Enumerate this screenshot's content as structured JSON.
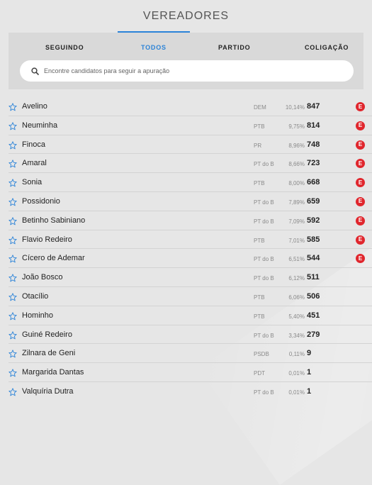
{
  "header": {
    "title": "VEREADORES"
  },
  "tabs": [
    {
      "label": "SEGUINDO"
    },
    {
      "label": "TODOS"
    },
    {
      "label": "PARTIDO"
    },
    {
      "label": "COLIGAÇÃO"
    }
  ],
  "search": {
    "placeholder": "Encontre candidatos para seguir a apuração",
    "icon": "search-icon"
  },
  "colors": {
    "accent": "#2b83d8",
    "elected_badge": "#e0262d",
    "star": "#2b83d8"
  },
  "elected_badge_label": "E",
  "candidates": [
    {
      "name": "Avelino",
      "party": "DEM",
      "pct": "10,14%",
      "votes": "847",
      "elected": true
    },
    {
      "name": "Neuminha",
      "party": "PTB",
      "pct": "9,75%",
      "votes": "814",
      "elected": true
    },
    {
      "name": "Finoca",
      "party": "PR",
      "pct": "8,96%",
      "votes": "748",
      "elected": true
    },
    {
      "name": "Amaral",
      "party": "PT do B",
      "pct": "8,66%",
      "votes": "723",
      "elected": true
    },
    {
      "name": "Sonia",
      "party": "PTB",
      "pct": "8,00%",
      "votes": "668",
      "elected": true
    },
    {
      "name": "Possidonio",
      "party": "PT do B",
      "pct": "7,89%",
      "votes": "659",
      "elected": true
    },
    {
      "name": "Betinho Sabiniano",
      "party": "PT do B",
      "pct": "7,09%",
      "votes": "592",
      "elected": true
    },
    {
      "name": "Flavio Redeiro",
      "party": "PTB",
      "pct": "7,01%",
      "votes": "585",
      "elected": true
    },
    {
      "name": "Cícero de Ademar",
      "party": "PT do B",
      "pct": "6,51%",
      "votes": "544",
      "elected": true
    },
    {
      "name": "João Bosco",
      "party": "PT do B",
      "pct": "6,12%",
      "votes": "511",
      "elected": false
    },
    {
      "name": "Otacílio",
      "party": "PTB",
      "pct": "6,06%",
      "votes": "506",
      "elected": false
    },
    {
      "name": "Hominho",
      "party": "PTB",
      "pct": "5,40%",
      "votes": "451",
      "elected": false
    },
    {
      "name": "Guiné Redeiro",
      "party": "PT do B",
      "pct": "3,34%",
      "votes": "279",
      "elected": false
    },
    {
      "name": "Zilnara de Geni",
      "party": "PSDB",
      "pct": "0,11%",
      "votes": "9",
      "elected": false
    },
    {
      "name": "Margarida Dantas",
      "party": "PDT",
      "pct": "0,01%",
      "votes": "1",
      "elected": false
    },
    {
      "name": "Valquíria Dutra",
      "party": "PT do B",
      "pct": "0,01%",
      "votes": "1",
      "elected": false
    }
  ]
}
